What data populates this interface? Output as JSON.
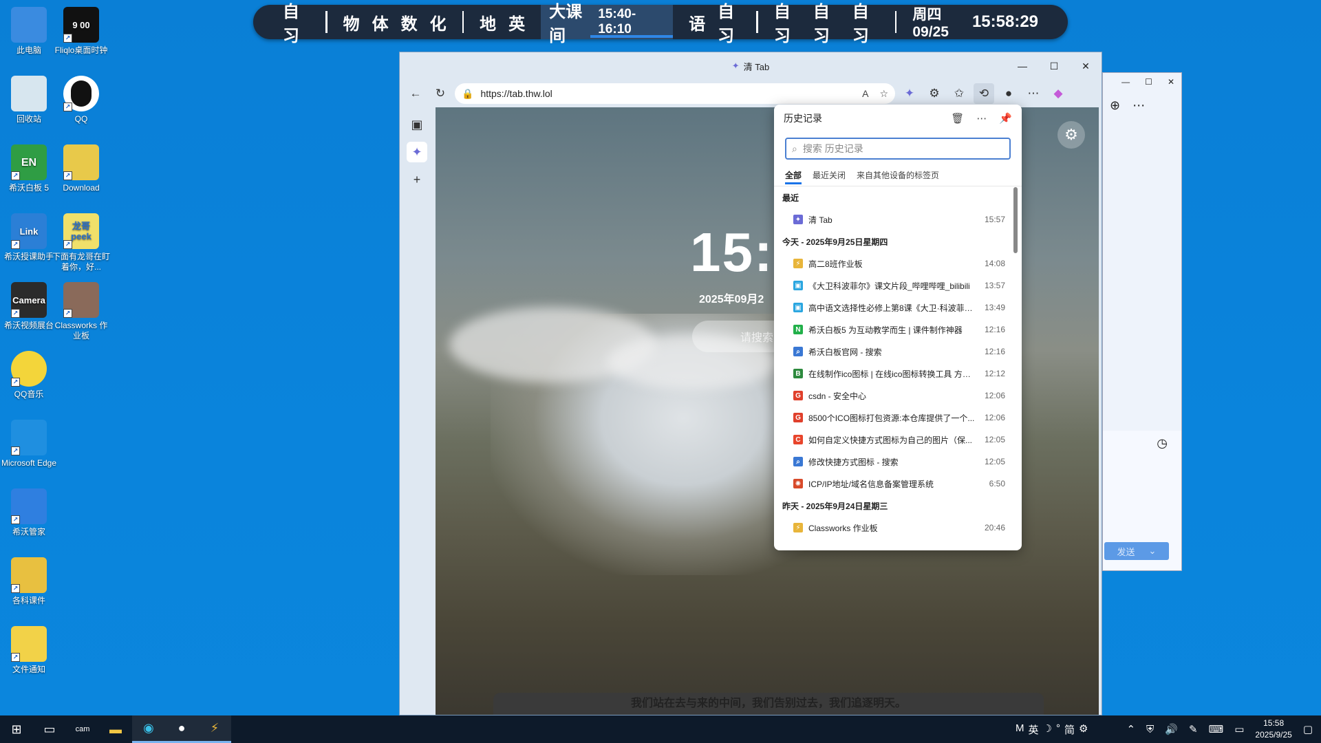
{
  "desktop": {
    "icons": [
      {
        "label": "此电脑",
        "icon": "computer-icon"
      },
      {
        "label": "Fliqlo桌面时钟",
        "icon": "clock-app-icon",
        "glyph": "9 00"
      },
      {
        "label": "回收站",
        "icon": "recycle-bin-icon"
      },
      {
        "label": "QQ",
        "icon": "qq-icon"
      },
      {
        "label": "希沃白板 5",
        "icon": "seewo-whiteboard-icon",
        "glyph": "EN"
      },
      {
        "label": "Download",
        "icon": "folder-icon"
      },
      {
        "label": "希沃授课助手",
        "icon": "link-icon",
        "glyph": "Link"
      },
      {
        "label": "下面有龙哥在盯着你，好...",
        "icon": "peek-icon",
        "glyph": "龙哥 peek"
      },
      {
        "label": "希沃视频展台",
        "icon": "camera-icon",
        "glyph": "Camera"
      },
      {
        "label": "Classworks 作业板",
        "icon": "portrait-icon"
      },
      {
        "label": "QQ音乐",
        "icon": "qq-music-icon"
      },
      {
        "label": "Microsoft Edge",
        "icon": "edge-icon"
      },
      {
        "label": "希沃管家",
        "icon": "shield-icon"
      },
      {
        "label": "各科课件",
        "icon": "courseware-folder-icon"
      },
      {
        "label": "文件通知",
        "icon": "warning-folder-icon"
      }
    ]
  },
  "schedule": {
    "group1": [
      "自习"
    ],
    "group2": [
      "物",
      "体",
      "数",
      "化"
    ],
    "group3": [
      "地",
      "英"
    ],
    "current": {
      "label": "大课间",
      "time": "15:40-16:10"
    },
    "group4": [
      "语",
      "自习"
    ],
    "group5": [
      "自习",
      "自习",
      "自习"
    ],
    "date": "周四 09/25",
    "clock": "15:58:29"
  },
  "browser": {
    "tab_title": "清 Tab",
    "url": "https://tab.thw.lol",
    "page": {
      "time": "15:",
      "date": "2025年09月2",
      "search_placeholder": "请搜索",
      "motto": "我们站在去与来的中间，我们告别过去，我们追逐明天。"
    }
  },
  "history": {
    "title": "历史记录",
    "search_placeholder": "搜索 历史记录",
    "tabs": [
      "全部",
      "最近关闭",
      "来自其他设备的标签页"
    ],
    "recent_label": "最近",
    "recent": [
      {
        "title": "清 Tab",
        "time": "15:57",
        "color": "#6b6bd6",
        "glyph": "✦"
      }
    ],
    "today_label": "今天 - 2025年9月25日星期四",
    "today": [
      {
        "title": "高二8班作业板",
        "time": "14:08",
        "color": "#e8b53a",
        "glyph": "⚡"
      },
      {
        "title": "《大卫科波菲尔》课文片段_哔哩哔哩_bilibili",
        "time": "13:57",
        "color": "#2aa6e0",
        "glyph": "▣"
      },
      {
        "title": "高中语文选择性必修上第8课《大卫·科波菲尔...",
        "time": "13:49",
        "color": "#2aa6e0",
        "glyph": "▣"
      },
      {
        "title": "希沃白板5 为互动教学而生 | 课件制作神器",
        "time": "12:16",
        "color": "#22b04a",
        "glyph": "N"
      },
      {
        "title": "希沃白板官网 - 搜索",
        "time": "12:16",
        "color": "#3a78d4",
        "glyph": "⌕"
      },
      {
        "title": "在线制作ico图标 | 在线ico图标转换工具 方便...",
        "time": "12:12",
        "color": "#2d8a3e",
        "glyph": "B"
      },
      {
        "title": "csdn - 安全中心",
        "time": "12:06",
        "color": "#e0402c",
        "glyph": "G"
      },
      {
        "title": "8500个ICO图标打包资源:本仓库提供了一个...",
        "time": "12:06",
        "color": "#e0402c",
        "glyph": "G"
      },
      {
        "title": "如何自定义快捷方式图标为自己的图片（保...",
        "time": "12:05",
        "color": "#e8452c",
        "glyph": "C"
      },
      {
        "title": "修改快捷方式图标 - 搜索",
        "time": "12:05",
        "color": "#3a78d4",
        "glyph": "⌕"
      },
      {
        "title": "ICP/IP地址/域名信息备案管理系统",
        "time": "6:50",
        "color": "#d84a2a",
        "glyph": "✺"
      }
    ],
    "yesterday_label": "昨天 - 2025年9月24日星期三",
    "yesterday": [
      {
        "title": "Classworks 作业板",
        "time": "20:46",
        "color": "#e8b53a",
        "glyph": "⚡"
      }
    ]
  },
  "side_window": {
    "send_label": "发送"
  },
  "taskbar": {
    "ime": [
      "M",
      "英",
      "☽",
      "°",
      "简",
      "⚙"
    ],
    "time": "15:58",
    "date": "2025/9/25"
  }
}
